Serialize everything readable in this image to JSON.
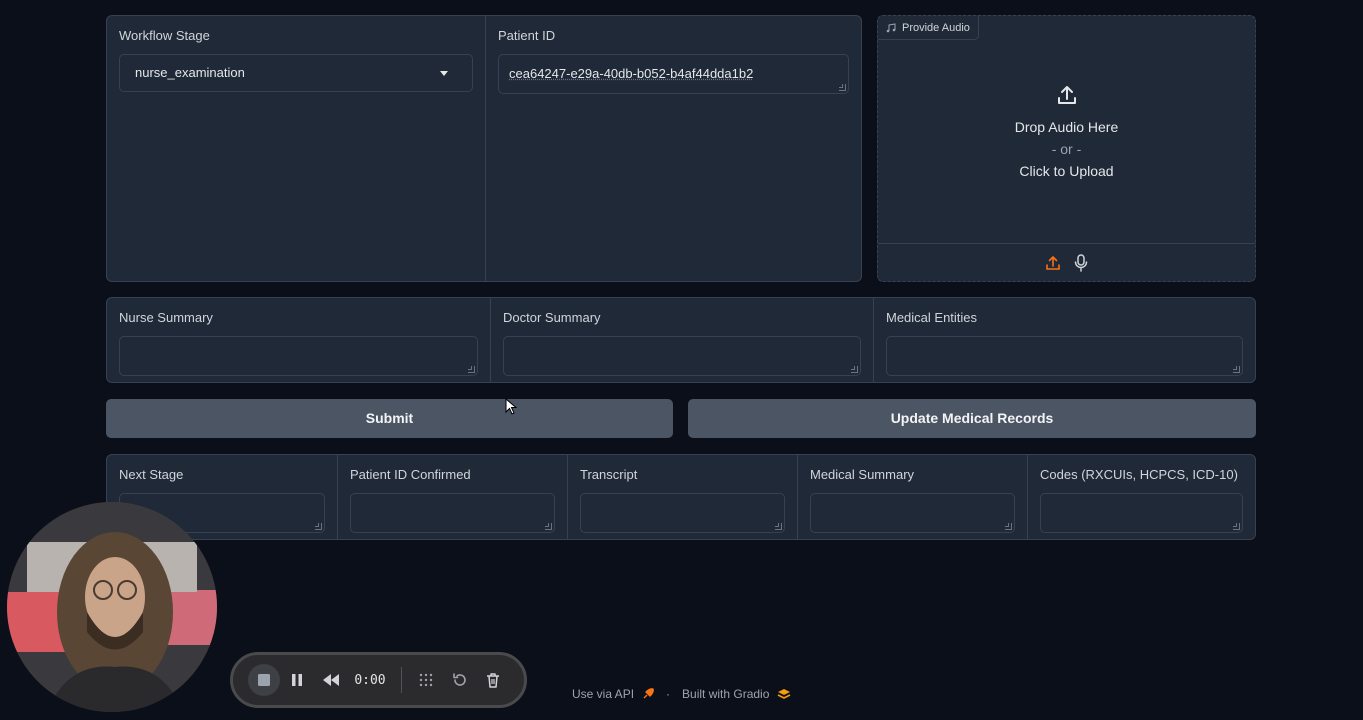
{
  "row1": {
    "workflow_stage": {
      "label": "Workflow Stage",
      "value": "nurse_examination"
    },
    "patient_id": {
      "label": "Patient ID",
      "value": "cea64247-e29a-40db-b052-b4af44dda1b2"
    },
    "audio": {
      "tag": "Provide Audio",
      "drop_text": "Drop Audio Here",
      "or_text": "- or -",
      "upload_text": "Click to Upload"
    }
  },
  "row2": {
    "nurse_summary": {
      "label": "Nurse Summary",
      "value": ""
    },
    "doctor_summary": {
      "label": "Doctor Summary",
      "value": ""
    },
    "medical_entities": {
      "label": "Medical Entities",
      "value": ""
    }
  },
  "buttons": {
    "submit": "Submit",
    "update": "Update Medical Records"
  },
  "row3": {
    "next_stage": {
      "label": "Next Stage",
      "value": ""
    },
    "patient_id_confirmed": {
      "label": "Patient ID Confirmed",
      "value": ""
    },
    "transcript": {
      "label": "Transcript",
      "value": ""
    },
    "medical_summary": {
      "label": "Medical Summary",
      "value": ""
    },
    "codes": {
      "label": "Codes (RXCUIs, HCPCS, ICD-10)",
      "value": ""
    }
  },
  "recorder": {
    "time": "0:00"
  },
  "footer": {
    "api": "Use via API",
    "dot": "·",
    "built": "Built with Gradio"
  },
  "colors": {
    "background": "#0b0f19",
    "panel": "#1f2937",
    "border": "#374151",
    "button": "#4b5563",
    "accent_upload": "#f97316",
    "gradio_logo": "#f59e0b"
  }
}
